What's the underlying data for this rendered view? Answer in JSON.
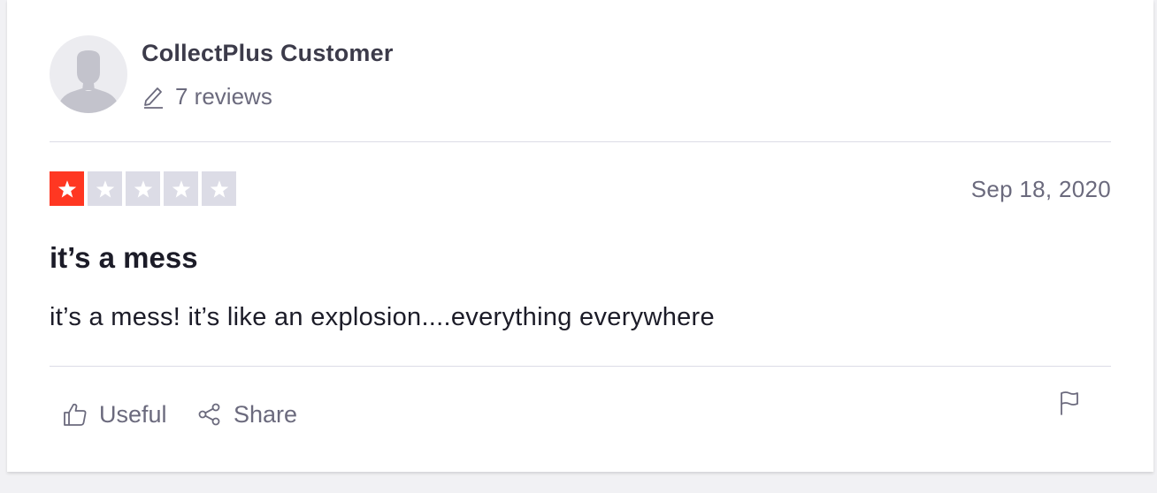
{
  "review": {
    "author": "CollectPlus Customer",
    "review_count": "7 reviews",
    "rating": 1,
    "rating_max": 5,
    "date": "Sep 18, 2020",
    "title": "it’s a mess",
    "body": "it’s a mess! it’s like an explosion....everything everywhere"
  },
  "actions": {
    "useful_label": "Useful",
    "share_label": "Share"
  },
  "colors": {
    "star_filled": "#ff3722",
    "star_empty": "#dcdce6",
    "text_primary": "#1c1c28",
    "text_secondary": "#6b6a7d"
  },
  "icons": [
    "avatar-silhouette",
    "pencil-icon",
    "star-icon",
    "thumbs-up-icon",
    "share-icon",
    "flag-icon"
  ]
}
